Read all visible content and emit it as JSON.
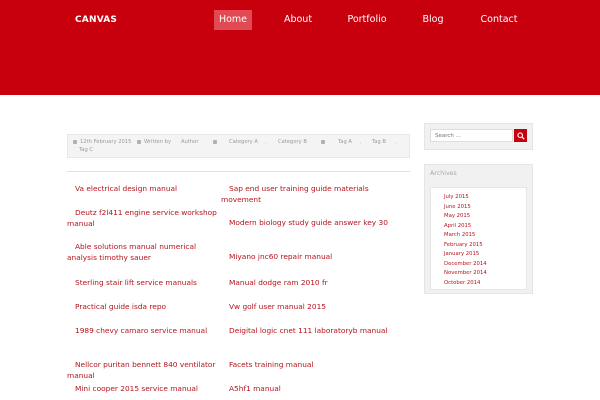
{
  "header": {
    "logo": "CANVAS",
    "nav": [
      "Home",
      "About",
      "Portfolio",
      "Blog",
      "Contact"
    ]
  },
  "post_meta": {
    "date": "12th February 2015",
    "written_by": "Written by",
    "author": "Author",
    "categories": [
      "Category A",
      "Category B"
    ],
    "tags": [
      "Tag A",
      "Tag B",
      "Tag C"
    ]
  },
  "links": [
    {
      "text": "Va electrical design manual"
    },
    {
      "text": "Sap end user training guide materials movement"
    },
    {
      "text": "Deutz f2l411 engine service workshop manual"
    },
    {
      "text": "Modern biology study guide answer key 30"
    },
    {
      "text": "Able solutions manual numerical analysis timothy sauer"
    },
    {
      "text": "Miyano jnc60 repair manual"
    },
    {
      "text": "Sterling stair lift service manuals"
    },
    {
      "text": "Manual dodge ram 2010 fr"
    },
    {
      "text": "Practical guide isda repo"
    },
    {
      "text": "Vw golf user manual 2015"
    },
    {
      "text": "1989 chevy camaro service manual"
    },
    {
      "text": "Deigital logic cnet 111 laboratoryb manual"
    },
    {
      "text": "Nellcor puritan bennett 840 ventilator manual"
    },
    {
      "text": "Facets training manual"
    },
    {
      "text": "Mini cooper 2015 service manual"
    },
    {
      "text": "A5hf1 manual"
    }
  ],
  "sidebar": {
    "search_placeholder": "Search ...",
    "archives_title": "Archives",
    "archives": [
      "July 2015",
      "June 2015",
      "May 2015",
      "April 2015",
      "March 2015",
      "February 2015",
      "January 2015",
      "December 2014",
      "November 2014",
      "October 2014"
    ]
  },
  "colors": {
    "brand_red": "#c8000e",
    "nav_active": "#e04a52",
    "link_red": "#b5131c"
  }
}
